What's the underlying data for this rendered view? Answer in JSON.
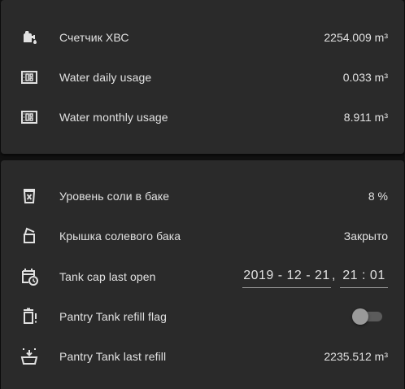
{
  "card_meters": {
    "rows": [
      {
        "icon": "water-pump-icon",
        "label": "Счетчик ХВС",
        "value": "2254.009 m³"
      },
      {
        "icon": "meter-icon",
        "label": "Water daily usage",
        "value": "0.033 m³"
      },
      {
        "icon": "meter-icon",
        "label": "Water monthly usage",
        "value": "8.911 m³"
      }
    ]
  },
  "card_softener": {
    "salt_level": {
      "icon": "salt-tank-icon",
      "label": "Уровень соли в баке",
      "value": "8 %"
    },
    "tank_cap": {
      "icon": "tank-cap-icon",
      "label": "Крышка солевого бака",
      "value": "Закрыто"
    },
    "tank_cap_last_open": {
      "icon": "calendar-clock-icon",
      "label": "Tank cap last open",
      "date": "2019 - 12 - 21",
      "separator": ",",
      "time": "21 : 01"
    },
    "pantry_refill_flag": {
      "icon": "trash-alert-icon",
      "label": "Pantry Tank refill flag",
      "state": "off"
    },
    "pantry_last_refill": {
      "icon": "basket-fill-icon",
      "label": "Pantry Tank last refill",
      "value": "2235.512 m³"
    }
  }
}
